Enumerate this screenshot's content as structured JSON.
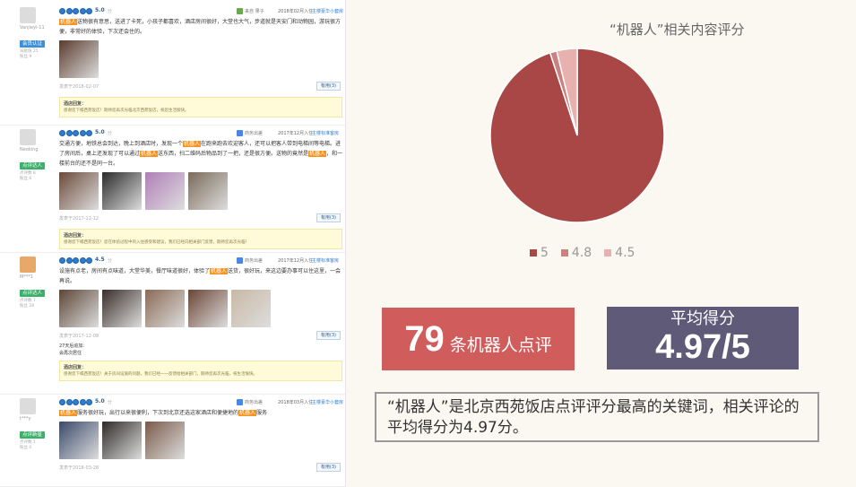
{
  "reviews": [
    {
      "user": "Vanjieyi-11",
      "badge": "会员认证",
      "stats": [
        "贡献值 25",
        "粉丝 9"
      ],
      "score": "5.0",
      "score_suffix": "分",
      "channel": "来自 果子",
      "date": "2018年02月入住",
      "host": "主楼豪华小套房",
      "text_parts": [
        {
          "t": "机器人",
          "hl": true
        },
        {
          "t": "送物很有意思，送进了卡死，小孩子都喜欢，酒店房间很好，大堂也大气，步道就是天安门和动物园，游玩很方便，非常好的体验，下次还会住的。",
          "hl": false
        }
      ],
      "photos": [
        "#5a3c2e"
      ],
      "foot": "发表于2018-02-07",
      "useful": "有用(3)",
      "reply_title": "酒店回复：",
      "reply_text": "感谢您下榻西苑饭店！期待您再次光临北京西苑饭店，祝您生活愉快。"
    },
    {
      "user": "Neoking",
      "badge": "点评达人",
      "stats": [
        "点评数 8",
        "粉丝 6"
      ],
      "score": "5.0",
      "score_suffix": "分",
      "channel": "商务出差",
      "date": "2017年12月入住",
      "host": "主楼标准客房",
      "text_parts": [
        {
          "t": "交通方便，地铁总会到达，晚上到酒店时，发现一个",
          "hl": false
        },
        {
          "t": "机器人",
          "hl": true
        },
        {
          "t": "在跑来跑去欢迎客人，还可以把客人带到电梯间等电梯。进了房间后，桌上还发现了可以通过",
          "hl": false
        },
        {
          "t": "机器人",
          "hl": true
        },
        {
          "t": "送东西，扫二维码后物品到了一把，还是很方便。送物的竟然是",
          "hl": false
        },
        {
          "t": "机器人",
          "hl": true
        },
        {
          "t": "，和一楼前台的还不是同一台。",
          "hl": false
        }
      ],
      "photos": [
        "#6b4a3a",
        "#2a2a2a",
        "#b07fb8",
        "#7a6a5a"
      ],
      "foot": "发表于2017-12-12",
      "useful": "有用(3)",
      "reply_title": "酒店回复：",
      "reply_text": "感谢您下榻西苑饭店！您在体验过程中的入住感受和建议，我们已经向相关部门反馈，期待您再次光临！"
    },
    {
      "user": "M***1",
      "badge": "点评达人",
      "stats": [
        "点评数 7",
        "粉丝 28"
      ],
      "score": "4.5",
      "score_suffix": "分",
      "channel": "商务出差",
      "date": "2017年12月入住",
      "host": "主楼标准客房",
      "text_parts": [
        {
          "t": "设施有点老，房间有点味道，大堂华美，餐厅味道很好，体验了",
          "hl": false
        },
        {
          "t": "机器人",
          "hl": true
        },
        {
          "t": "送货，很好玩，来这边要办事可以住这里，一会再说。",
          "hl": false
        }
      ],
      "photos": [
        "#5b4636",
        "#3a2e2a",
        "#8a6a55",
        "#6a4535",
        "#c9b8a5"
      ],
      "foot": "发表于2017-12-08",
      "useful": "有用(3)",
      "extra_title": "27天后追加：",
      "extra_text": "会再次居住",
      "reply_title": "酒店回复：",
      "reply_text": "感谢您下榻西苑饭店！关于房间设施的问题，我们已经一一反馈给相关部门，期待您再次光临，祝生活愉快。"
    },
    {
      "user": "t***y",
      "badge": "点评新星",
      "stats": [
        "点评数 1",
        "粉丝 0"
      ],
      "score": "5.0",
      "score_suffix": "分",
      "channel": "商务出差",
      "date": "2018年03月入住",
      "host": "主楼豪华小套房",
      "text_parts": [
        {
          "t": "机器人",
          "hl": true
        },
        {
          "t": "服务很好玩，出行以来很便利，下次到北京还选这家酒店和便捷地的",
          "hl": false
        },
        {
          "t": "机器人",
          "hl": true
        },
        {
          "t": "服务",
          "hl": false
        }
      ],
      "photos": [
        "#3a4a6a",
        "#2e2a28",
        "#7a5a4a"
      ],
      "foot": "发表于2018-03-28",
      "useful": "有用(3)"
    }
  ],
  "chart_data": {
    "type": "pie",
    "title": "“机器人”相关内容评分",
    "labels": [
      "5",
      "4.8",
      "4.5"
    ],
    "values": [
      75,
      1,
      3
    ],
    "colors": [
      "#a94747",
      "#c98181",
      "#e6b1af"
    ],
    "legend_position": "bottom"
  },
  "stats": {
    "count": "79",
    "count_label": "条机器人点评",
    "avg_label": "平均得分",
    "avg_value": "4.97/5"
  },
  "summary": "“机器人”是北京西苑饭店点评评分最高的关键词，相关评论的平均得分为4.97分。"
}
